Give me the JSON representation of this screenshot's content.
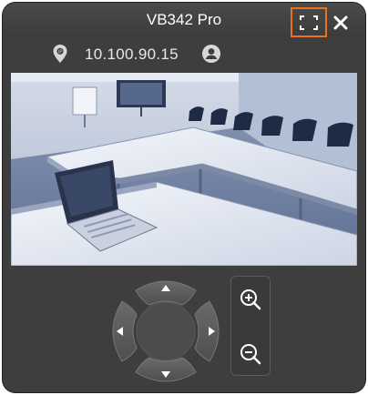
{
  "window": {
    "title": "VB342 Pro",
    "accent_color": "#e8731f",
    "background_color": "#3e3e3e"
  },
  "titlebar": {
    "fullscreen_icon": "fullscreen-icon",
    "close_icon": "close-icon"
  },
  "infobar": {
    "location_icon": "map-pin-icon",
    "ip_address": "10.100.90.15",
    "user_icon": "user-icon"
  },
  "video": {
    "content": "camera-feed"
  },
  "ptz": {
    "up_icon": "arrow-up-icon",
    "down_icon": "arrow-down-icon",
    "left_icon": "arrow-left-icon",
    "right_icon": "arrow-right-icon"
  },
  "zoom": {
    "in_icon": "zoom-in-icon",
    "out_icon": "zoom-out-icon"
  }
}
